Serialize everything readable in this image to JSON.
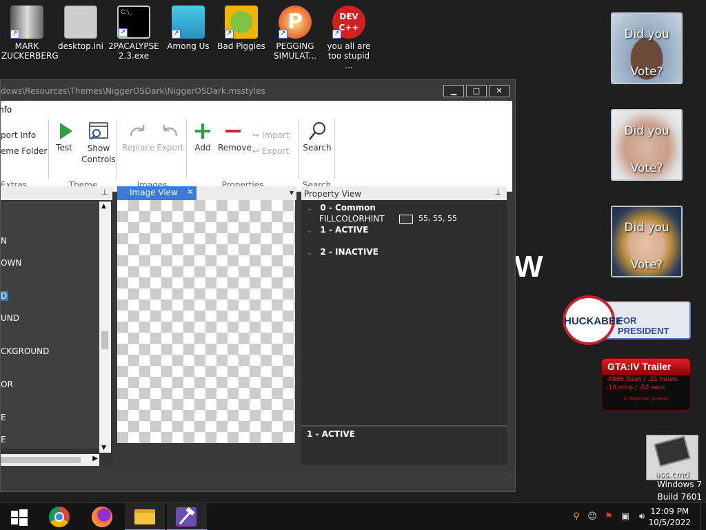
{
  "desktop": {
    "icons": [
      {
        "label": "MARK ZUCKERBERG"
      },
      {
        "label": "desktop.ini"
      },
      {
        "label": "2PACALYPSE 2.3.exe"
      },
      {
        "label": "Among Us"
      },
      {
        "label": "Bad Piggies"
      },
      {
        "label": "PEGGING SIMULAT..."
      },
      {
        "label": "you all are too stupid ..."
      }
    ],
    "ass_cmd_label": "ass.cmd",
    "watermark_line1": "Windows 7",
    "watermark_line2": "Build 7601"
  },
  "gadgets": {
    "vote_line1": "Did you",
    "vote_line2": "Vote?",
    "huckabee_name": "HUCKABEE",
    "huckabee_text": "FOR PRESIDENT",
    "gta_title": "GTA:IV Trailer",
    "gta_line1": "-6889 Days / -21 hours",
    "gta_line2": "-10 mins / -52 secs",
    "gta_footer": "© Rockstar Games",
    "big_letter": "W"
  },
  "window": {
    "title": "dows\\Resources\\Themes\\NiggerOSDark\\NiggerOSDark.msstyles",
    "minimize": "▁",
    "maximize": "□",
    "close": "✕",
    "menu_item": "nfo"
  },
  "ribbon": {
    "extras": {
      "label": "Extras",
      "import_info": "port Info",
      "theme_folder": "eme Folder"
    },
    "theme": {
      "label": "Theme",
      "test": "Test",
      "show_controls_1": "Show",
      "show_controls_2": "Controls"
    },
    "images": {
      "label": "Images",
      "replace": "Replace",
      "export": "Export"
    },
    "properties": {
      "label": "Properties",
      "add": "Add",
      "remove": "Remove",
      "import": "Import",
      "export": "Export"
    },
    "search": {
      "label": "Search",
      "search": "Search"
    }
  },
  "left_list": [
    "N",
    "OWN",
    "D",
    "UND",
    "CKGROUND",
    "OR",
    "E",
    "E"
  ],
  "image_view": {
    "tab_label": "Image View"
  },
  "property_view": {
    "header": "Property View",
    "groups": [
      {
        "name": "0 - Common"
      },
      {
        "name": "1 - ACTIVE"
      },
      {
        "name": "2 - INACTIVE"
      }
    ],
    "prop_name": "FILLCOLORHINT",
    "prop_value": "55, 55, 55",
    "description": "1 - ACTIVE"
  },
  "taskbar": {
    "time": "12:09 PM",
    "date": "10/5/2022"
  },
  "colors": {
    "accent": "#3b7ad8",
    "add_green": "#2aa33a",
    "remove_red": "#c62828"
  }
}
